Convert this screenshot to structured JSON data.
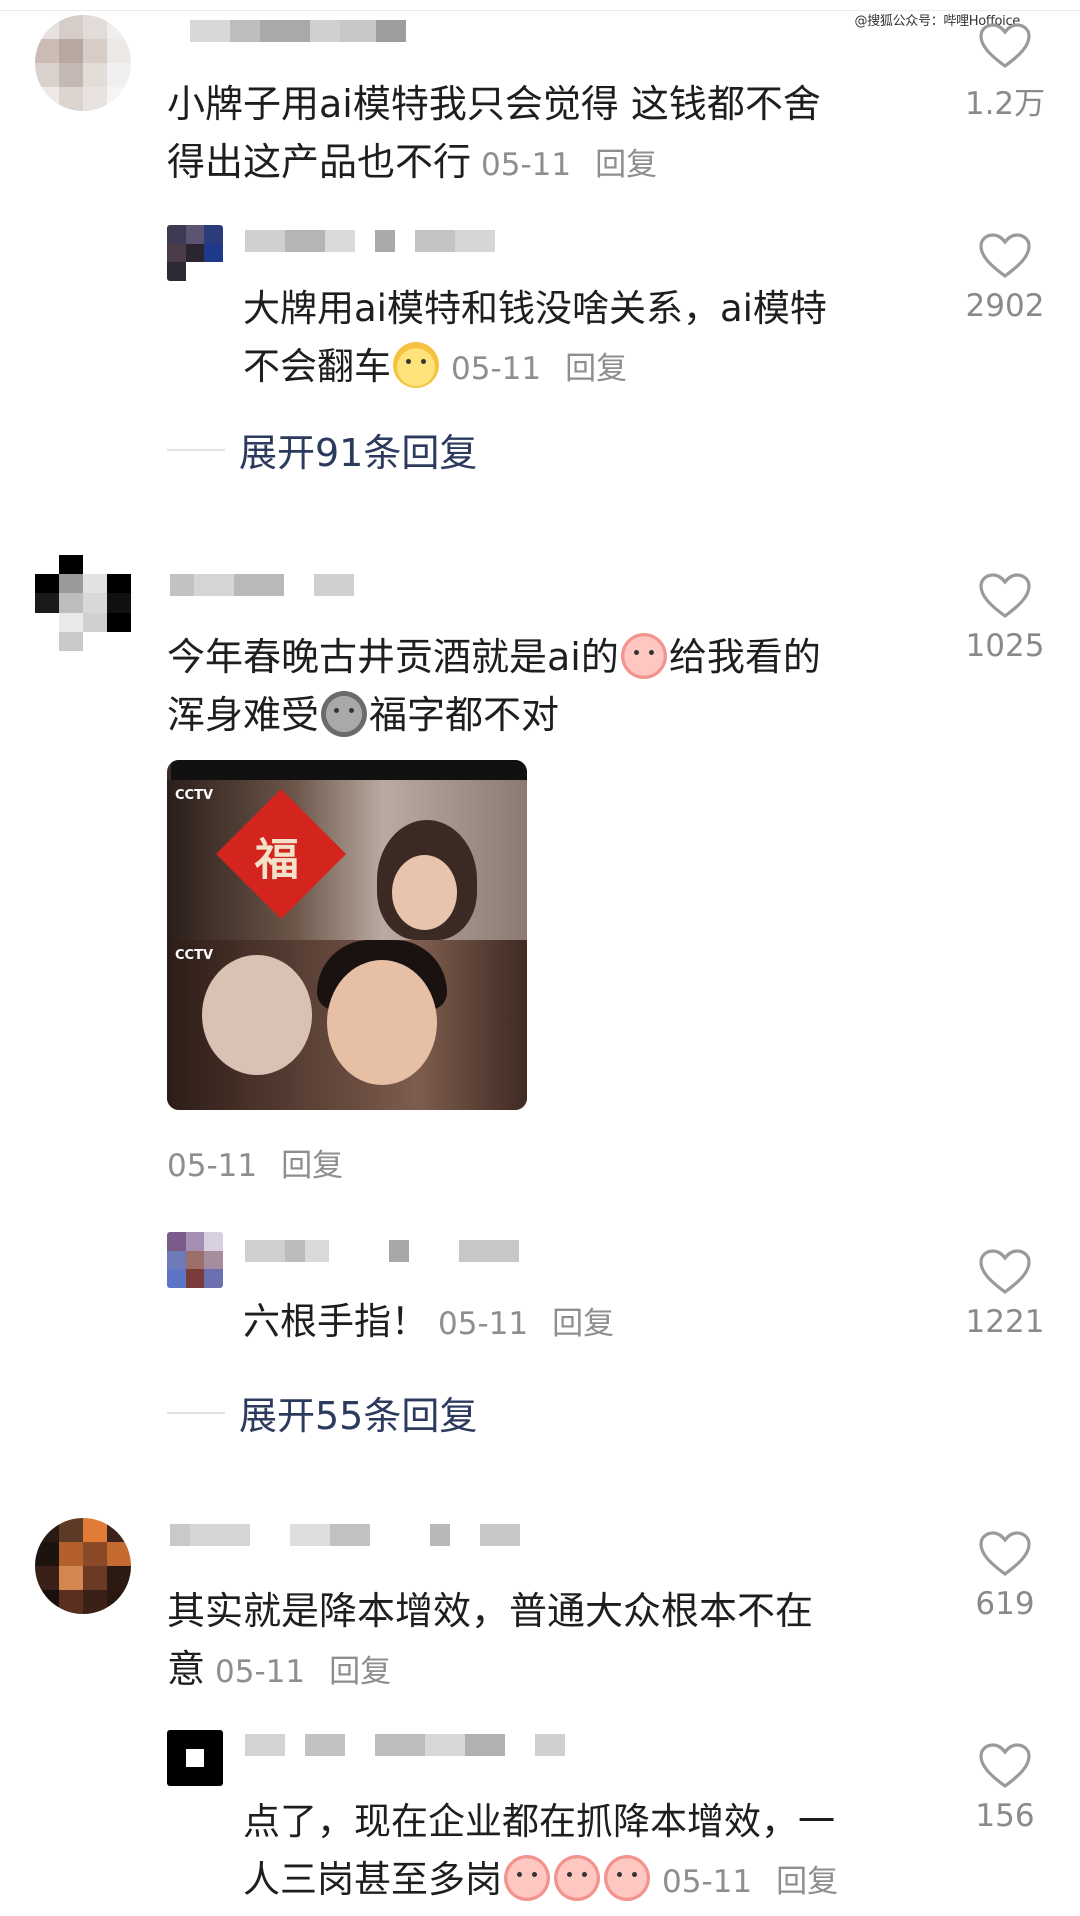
{
  "watermark": "@搜狐公众号：哔哩Hoffoice",
  "comments": [
    {
      "id": "c1",
      "text_lines": [
        "小牌子用ai模特我只会觉得 这钱都不舍",
        "得出这产品也不行"
      ],
      "date": "05-11",
      "reply_label": "回复",
      "likes": "1.2万"
    },
    {
      "id": "c1r1",
      "text_lines": [
        "大牌用ai模特和钱没啥关系，ai模特",
        "不会翻车"
      ],
      "date": "05-11",
      "reply_label": "回复",
      "likes": "2902"
    },
    {
      "id": "c2",
      "text_lines": [
        "今年春晚古井贡酒就是ai的",
        "给我看的",
        "浑身难受",
        "福字都不对"
      ],
      "date": "05-11",
      "reply_label": "回复",
      "likes": "1025"
    },
    {
      "id": "c2r1",
      "text_lines": [
        "六根手指！"
      ],
      "date": "05-11",
      "reply_label": "回复",
      "likes": "1221"
    },
    {
      "id": "c3",
      "text_lines": [
        "其实就是降本增效，普通大众根本不在",
        "意"
      ],
      "date": "05-11",
      "reply_label": "回复",
      "likes": "619"
    },
    {
      "id": "c3r1",
      "text_lines": [
        "点了，现在企业都在抓降本增效，一",
        "人三岗甚至多岗"
      ],
      "date": "05-11",
      "reply_label": "回复",
      "likes": "156"
    }
  ],
  "expand": [
    {
      "label": "展开91条回复"
    },
    {
      "label": "展开55条回复"
    }
  ],
  "thumbnail": {
    "fu_char": "福",
    "logo": "CCTV"
  },
  "colors": {
    "text": "#1e1e1e",
    "meta": "#8e8e8e",
    "expand": "#2c3a5e",
    "heart": "#9a9a9a"
  },
  "icons": {
    "like": "heart-outline-icon",
    "emoji_1": "dog-face-emoji-icon",
    "emoji_2": "crying-face-emoji-icon",
    "emoji_3": "grey-blob-emoji-icon"
  }
}
